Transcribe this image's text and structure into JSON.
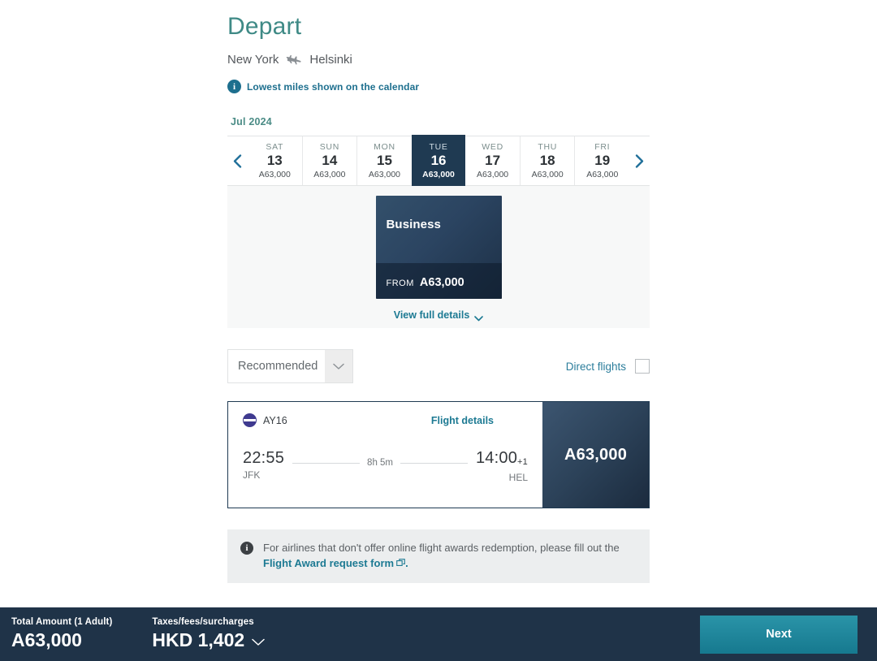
{
  "header": {
    "title": "Depart",
    "origin": "New York",
    "destination": "Helsinki",
    "plane_icon": "plane-icon",
    "notice_icon": "info-icon",
    "notice_text": "Lowest miles shown on the calendar"
  },
  "calendar": {
    "month_label": "Jul 2024",
    "prev_icon": "chevron-left-icon",
    "next_icon": "chevron-right-icon",
    "days": [
      {
        "dow": "SAT",
        "dom": "13",
        "price": "63,000",
        "selected": false
      },
      {
        "dow": "SUN",
        "dom": "14",
        "price": "63,000",
        "selected": false
      },
      {
        "dow": "MON",
        "dom": "15",
        "price": "63,000",
        "selected": false
      },
      {
        "dow": "TUE",
        "dom": "16",
        "price": "63,000",
        "selected": true
      },
      {
        "dow": "WED",
        "dom": "17",
        "price": "63,000",
        "selected": false
      },
      {
        "dow": "THU",
        "dom": "18",
        "price": "63,000",
        "selected": false
      },
      {
        "dow": "FRI",
        "dom": "19",
        "price": "63,000",
        "selected": false
      }
    ]
  },
  "cabin": {
    "name": "Business",
    "from_label": "FROM",
    "from_amount": "63,000",
    "view_details_label": "View full details",
    "view_details_icon": "chevron-down-icon"
  },
  "filters": {
    "sort_value": "Recommended",
    "sort_caret_icon": "chevron-down-icon",
    "direct_label": "Direct flights",
    "direct_checked": false
  },
  "flight": {
    "airline_logo": "finnair-logo-icon",
    "flight_number": "AY16",
    "details_link": "Flight details",
    "depart_time": "22:55",
    "depart_code": "JFK",
    "duration": "8h 5m",
    "arrive_time": "14:00",
    "arrive_day_offset": "+1",
    "arrive_code": "HEL",
    "price": "63,000"
  },
  "notice": {
    "icon": "info-icon",
    "text_before": "For airlines that don't offer online flight awards redemption, please fill out the",
    "link_text": "Flight Award request form",
    "link_icon": "external-link-icon",
    "text_after": "."
  },
  "bottom": {
    "total_label": "Total Amount (1 Adult)",
    "total_value": "63,000",
    "taxes_label": "Taxes/fees/surcharges",
    "taxes_value": "HKD 1,402",
    "taxes_caret_icon": "chevron-down-icon",
    "next_label": "Next"
  },
  "colors": {
    "teal_title": "#3f8a86",
    "link_teal": "#1d7a93",
    "navy": "#1f3348",
    "panel_gray": "#f7f8f8",
    "next_button": "#16798f"
  },
  "symbols": {
    "miles": "A"
  }
}
